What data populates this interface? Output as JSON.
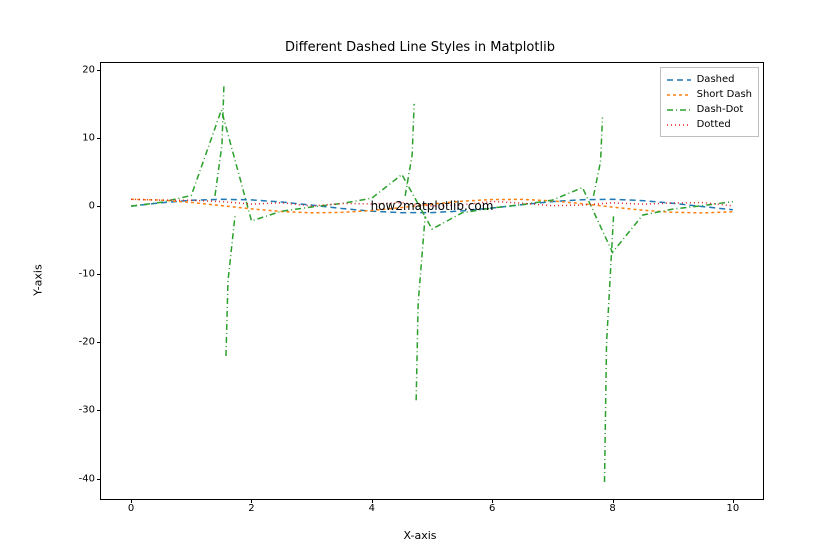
{
  "chart_data": {
    "type": "line",
    "title": "Different Dashed Line Styles in Matplotlib",
    "xlabel": "X-axis",
    "ylabel": "Y-axis",
    "xlim": [
      -0.5,
      10.5
    ],
    "ylim": [
      -43,
      21
    ],
    "x": [
      0,
      0.5,
      1,
      1.5,
      2,
      2.5,
      3,
      3.5,
      4,
      4.5,
      5,
      5.5,
      6,
      6.5,
      7,
      7.5,
      8,
      8.5,
      9,
      9.5,
      10
    ],
    "series": [
      {
        "name": "Dashed",
        "color": "#1f77b4",
        "style": "dashed",
        "values": [
          0,
          0.479,
          0.841,
          0.997,
          0.909,
          0.599,
          0.141,
          -0.351,
          -0.757,
          -0.978,
          -0.959,
          -0.706,
          -0.279,
          0.215,
          0.657,
          0.938,
          0.989,
          0.798,
          0.412,
          -0.075,
          -0.544
        ]
      },
      {
        "name": "Short Dash",
        "color": "#ff7f0e",
        "style": "shortdash",
        "values": [
          1,
          0.878,
          0.54,
          0.071,
          -0.416,
          -0.801,
          -0.99,
          -0.936,
          -0.654,
          -0.211,
          0.284,
          0.709,
          0.96,
          0.977,
          0.754,
          0.347,
          -0.146,
          -0.602,
          -0.911,
          -0.997,
          -0.839
        ]
      },
      {
        "name": "Dash-Dot",
        "color": "#2ca02c",
        "style": "dashdot",
        "values": [
          0,
          0.546,
          1.557,
          14.1,
          -2.185,
          -0.747,
          -0.143,
          0.375,
          1.158,
          4.637,
          -3.381,
          -0.996,
          -0.291,
          0.22,
          0.871,
          2.706,
          -6.8,
          -1.326,
          -0.452,
          0.075,
          0.648
        ],
        "spikes": [
          {
            "x": 1.56,
            "up": 18,
            "dn": -22
          },
          {
            "x": 4.72,
            "up": 15,
            "dn": -28.5
          },
          {
            "x": 7.85,
            "up": 13,
            "dn": -40.5
          }
        ]
      },
      {
        "name": "Dotted",
        "color": "#d62728",
        "style": "dotted",
        "values": [
          1,
          0.878,
          0.841,
          0.65,
          0.284,
          0.494,
          0.005,
          0.38,
          0.322,
          0.491,
          0.006,
          0.165,
          0.688,
          0.426,
          0.053,
          0.152,
          0.486,
          0.274,
          0.448,
          0.502,
          0.031
        ]
      }
    ],
    "xticks": [
      0,
      2,
      4,
      6,
      8,
      10
    ],
    "yticks": [
      -40,
      -30,
      -20,
      -10,
      0,
      10,
      20
    ],
    "annotation": "how2matplotlib.com"
  },
  "legend": {
    "items": [
      {
        "label": "Dashed"
      },
      {
        "label": "Short Dash"
      },
      {
        "label": "Dash-Dot"
      },
      {
        "label": "Dotted"
      }
    ]
  }
}
